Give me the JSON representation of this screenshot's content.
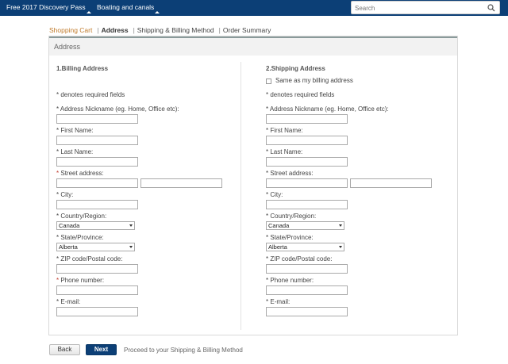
{
  "topnav": {
    "items": [
      "Free 2017 Discovery Pass",
      "Boating and canals"
    ],
    "search_placeholder": "Search"
  },
  "breadcrumb": {
    "steps": [
      "Shopping Cart",
      "Address",
      "Shipping & Billing Method",
      "Order Summary"
    ],
    "separator": "|"
  },
  "panel": {
    "title": "Address"
  },
  "billing": {
    "title": "1.Billing Address",
    "required_note": "* denotes required fields",
    "labels": {
      "nickname": "Address Nickname (eg. Home, Office etc):",
      "first_name": "First Name:",
      "last_name": "Last Name:",
      "street": "Street address:",
      "city": "City:",
      "country": "Country/Region:",
      "state": "State/Province:",
      "zip": "ZIP code/Postal code:",
      "phone": "Phone number:",
      "email": "E-mail:"
    },
    "country_value": "Canada",
    "state_value": "Alberta"
  },
  "shipping": {
    "title": "2.Shipping Address",
    "same_as_billing": "Same as my billing address",
    "required_note": "* denotes required fields",
    "labels": {
      "nickname": "Address Nickname (eg. Home, Office etc):",
      "first_name": "First Name:",
      "last_name": "Last Name:",
      "street": "Street address:",
      "city": "City:",
      "country": "Country/Region:",
      "state": "State/Province:",
      "zip": "ZIP code/Postal code:",
      "phone": "Phone number:",
      "email": "E-mail:"
    },
    "country_value": "Canada",
    "state_value": "Alberta"
  },
  "asterisk": "*",
  "buttons": {
    "back": "Back",
    "next": "Next",
    "hint": "Proceed to your Shipping & Billing Method"
  },
  "colors": {
    "topbar": "#0c3f76",
    "breadcrumb_done": "#c07a2a",
    "required_red": "#c0392b"
  }
}
